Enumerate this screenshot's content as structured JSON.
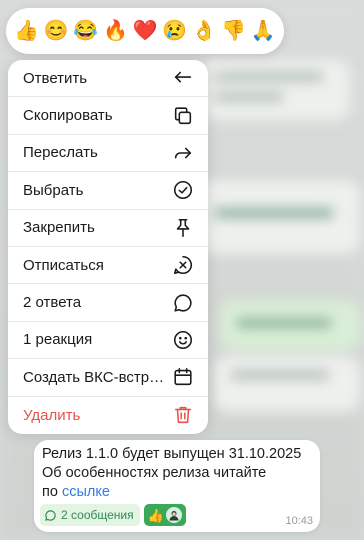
{
  "reactions": [
    {
      "emoji": "👍",
      "name": "thumbs-up"
    },
    {
      "emoji": "😊",
      "name": "smiling-face"
    },
    {
      "emoji": "😂",
      "name": "tears-of-joy"
    },
    {
      "emoji": "🔥",
      "name": "fire"
    },
    {
      "emoji": "❤️",
      "name": "red-heart"
    },
    {
      "emoji": "😢",
      "name": "crying-face"
    },
    {
      "emoji": "👌",
      "name": "ok-hand"
    },
    {
      "emoji": "👎",
      "name": "thumbs-down"
    },
    {
      "emoji": "🙏",
      "name": "folded-hands"
    }
  ],
  "menu": {
    "items": [
      {
        "label": "Ответить",
        "icon": "reply-icon"
      },
      {
        "label": "Скопировать",
        "icon": "copy-icon"
      },
      {
        "label": "Переслать",
        "icon": "forward-icon"
      },
      {
        "label": "Выбрать",
        "icon": "select-check-icon"
      },
      {
        "label": "Закрепить",
        "icon": "pin-icon"
      },
      {
        "label": "Отписаться",
        "icon": "unsubscribe-icon"
      },
      {
        "label": "2 ответа",
        "icon": "chat-bubble-icon"
      },
      {
        "label": "1 реакция",
        "icon": "smiley-icon"
      },
      {
        "label": "Создать ВКС-встречу",
        "icon": "calendar-icon"
      },
      {
        "label": "Удалить",
        "icon": "trash-icon"
      }
    ]
  },
  "message": {
    "line1": "Релиз 1.1.0 будет выпущен 31.10.2025",
    "line2": "Об особенностях релиза читайте",
    "line3_prefix": "по",
    "link_text": "ссылке",
    "thread_label": "2 сообщения",
    "reaction_emoji": "👍",
    "time": "10:43"
  },
  "colors": {
    "accent": "#2f7de1",
    "danger": "#e5534b",
    "thread": "#2e8b57",
    "reaction_chip": "#3aa856"
  }
}
